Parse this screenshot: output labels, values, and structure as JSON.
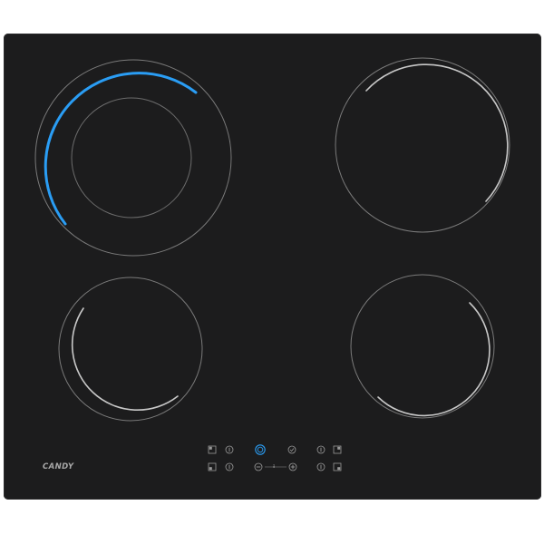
{
  "brand": {
    "name": "CANDY"
  },
  "colors": {
    "glass": "#1c1c1d",
    "ring": "#b9b9b9",
    "ring_faint": "#5a5a5a",
    "active": "#2a9df4",
    "key": "#9a9a9a"
  },
  "zones": [
    {
      "name": "front-left-zone",
      "active": true
    },
    {
      "name": "rear-right-zone",
      "active": false
    },
    {
      "name": "rear-left-zone",
      "active": false
    },
    {
      "name": "front-right-zone",
      "active": false
    }
  ],
  "controls": {
    "power_icon": "power-icon",
    "lock_icon": "lock-icon",
    "timer_icon": "timer-icon",
    "minus_icon": "minus-icon",
    "plus_icon": "plus-icon",
    "zone_select_icon": "zone-select-icon",
    "indicator_icon": "indicator-icon",
    "slider_marker": "ᵻ"
  }
}
